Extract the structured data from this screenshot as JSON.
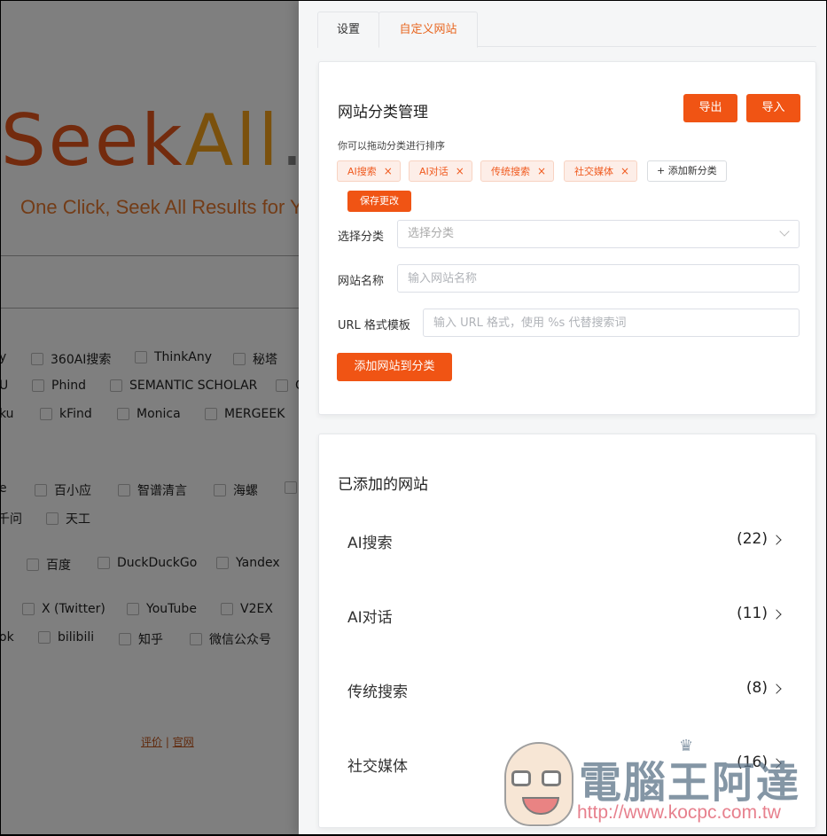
{
  "background_page": {
    "logo": {
      "seek": "Seek",
      "all": "All",
      "dot": ".c"
    },
    "tagline": "One Click, Seek All Results for Yo",
    "checkbox_rows": [
      {
        "items": [
          {
            "label": "y",
            "partial": true
          },
          {
            "label": "360AI搜索"
          },
          {
            "label": "ThinkAny"
          },
          {
            "label": "秘塔"
          }
        ]
      },
      {
        "items": [
          {
            "label": "U",
            "partial": true
          },
          {
            "label": "Phind"
          },
          {
            "label": "SEMANTIC SCHOLAR"
          },
          {
            "label": "C",
            "partial": true
          }
        ]
      },
      {
        "items": [
          {
            "label": "ku",
            "partial": true
          },
          {
            "label": "kFind"
          },
          {
            "label": "Monica"
          },
          {
            "label": "MERGEEK"
          }
        ]
      },
      {
        "items": [
          {
            "label": "e",
            "partial": true
          },
          {
            "label": "百小应"
          },
          {
            "label": "智谱清言"
          },
          {
            "label": "海螺"
          }
        ]
      },
      {
        "items": [
          {
            "label": "千问",
            "partial": true
          },
          {
            "label": "天工"
          }
        ]
      },
      {
        "items": [
          {
            "label": "百度"
          },
          {
            "label": "DuckDuckGo"
          },
          {
            "label": "Yandex"
          }
        ]
      },
      {
        "items": [
          {
            "label": "X (Twitter)"
          },
          {
            "label": "YouTube"
          },
          {
            "label": "V2EX"
          }
        ]
      },
      {
        "items": [
          {
            "label": "ok",
            "partial": true
          },
          {
            "label": "bilibili"
          },
          {
            "label": "知乎"
          },
          {
            "label": "微信公众号"
          }
        ]
      }
    ],
    "footer": {
      "review": "评价",
      "separator": "|",
      "official": "官网"
    }
  },
  "panel": {
    "tabs": [
      {
        "label": "设置",
        "active": false
      },
      {
        "label": "自定义网站",
        "active": true
      }
    ],
    "category_management": {
      "title": "网站分类管理",
      "export_label": "导出",
      "import_label": "导入",
      "hint": "你可以拖动分类进行排序",
      "tags": [
        {
          "label": "AI搜索",
          "close": "×"
        },
        {
          "label": "AI对话",
          "close": "×"
        },
        {
          "label": "传统搜索",
          "close": "×"
        },
        {
          "label": "社交媒体",
          "close": "×"
        }
      ],
      "add_tag_label": "+ 添加新分类",
      "save_label": "保存更改",
      "form": {
        "category_label": "选择分类",
        "category_placeholder": "选择分类",
        "name_label": "网站名称",
        "name_placeholder": "输入网站名称",
        "url_label": "URL 格式模板",
        "url_placeholder": "输入 URL 格式，使用 %s 代替搜索词",
        "submit_label": "添加网站到分类"
      }
    },
    "added_sites": {
      "title": "已添加的网站",
      "categories": [
        {
          "name": "AI搜索",
          "count": "(22)"
        },
        {
          "name": "AI对话",
          "count": "(11)"
        },
        {
          "name": "传统搜索",
          "count": "(8)"
        },
        {
          "name": "社交媒体",
          "count": "(16)"
        }
      ]
    }
  },
  "watermark": {
    "text": "電腦王阿達",
    "url": "http://www.kocpc.com.tw"
  },
  "colors": {
    "accent": "#f05414",
    "tag_bg": "#fdeee8",
    "tab_active_text": "#e8661f",
    "panel_bg": "#f5f6f7"
  }
}
